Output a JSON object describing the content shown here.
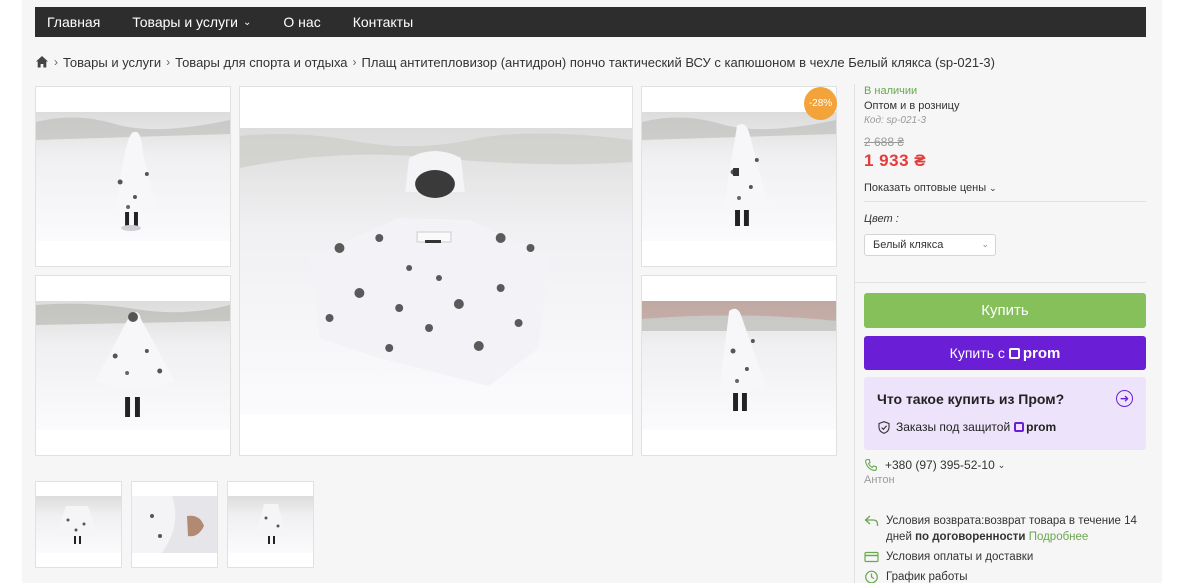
{
  "nav": {
    "items": [
      {
        "label": "Главная"
      },
      {
        "label": "Товары и услуги",
        "dropdown": true
      },
      {
        "label": "О нас"
      },
      {
        "label": "Контакты"
      }
    ]
  },
  "breadcrumb": {
    "items": [
      "Товары и услуги",
      "Товары для спорта и отдыха",
      "Плащ антитепловизор (антидрон) пончо тактический ВСУ с капюшоном в чехле Белый клякса (sp-021-3)"
    ]
  },
  "gallery": {
    "discount_badge": "-28%"
  },
  "product": {
    "availability": "В наличии",
    "sale_type": "Оптом и в розницу",
    "code": "Код: sp-021-3",
    "old_price": "2 688 ₴",
    "price": "1 933 ₴",
    "wholesale_link": "Показать оптовые цены",
    "color_label": "Цвет :",
    "color_value": "Белый клякса"
  },
  "buttons": {
    "buy": "Купить",
    "buy_prom_prefix": "Купить с",
    "prom_word": "prom"
  },
  "prom_info": {
    "question": "Что такое купить из Пром?",
    "protection": "Заказы под защитой",
    "prom_word": "prom"
  },
  "contact": {
    "phone": "+380 (97) 395-52-10",
    "name": "Антон"
  },
  "conditions": {
    "return_text_1": "Условия возврата:возврат товара в течение 14",
    "return_text_2_prefix": "дней",
    "return_text_2_bold": "по договоренности",
    "return_more": "Подробнее",
    "payment_delivery": "Условия оплаты и доставки",
    "schedule": "График работы"
  },
  "colors": {
    "nav_bg": "#2d2d2d",
    "buy_green": "#86c05b",
    "prom_purple": "#6a1fd6",
    "price_red": "#e23c3c",
    "badge_orange": "#f2a33a",
    "stock_green": "#6aa84f"
  }
}
